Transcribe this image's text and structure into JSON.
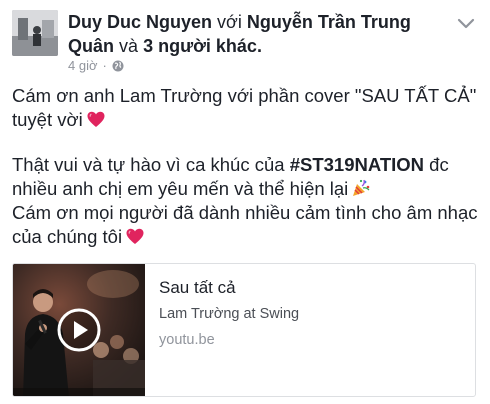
{
  "header": {
    "author": "Duy Duc Nguyen",
    "with_word": "với",
    "tagged": "Nguyễn Trần Trung Quân",
    "and_word": "và",
    "others": "3 người khác",
    "end_dot": "."
  },
  "meta": {
    "time": "4 giờ",
    "separator": "·",
    "privacy_icon": "globe-icon"
  },
  "post": {
    "para1": "Cám ơn anh Lam Trường với phần cover \"SAU TẤT CẢ\" tuyệt vời",
    "para2_before": "Thật vui và tự hào vì ca khúc của ",
    "para2_hashtag": "#ST319NATION",
    "para2_after": " đc nhiều anh chị em yêu mến và thể hiện lại",
    "para3": "Cám ơn mọi người đã dành nhiều cảm tình cho âm nhạc của chúng tôi",
    "emoji": [
      "red-heart-icon",
      "party-popper-icon",
      "red-heart-icon"
    ]
  },
  "link_card": {
    "title": "Sau tất cả",
    "description": "Lam Trường at Swing",
    "domain": "youtu.be",
    "thumbnail_icon": "video-thumbnail",
    "play_icon": "play-icon"
  },
  "colors": {
    "text": "#1d2129",
    "meta": "#90949c",
    "border": "#dddfe2",
    "heart": "#e0245e"
  }
}
